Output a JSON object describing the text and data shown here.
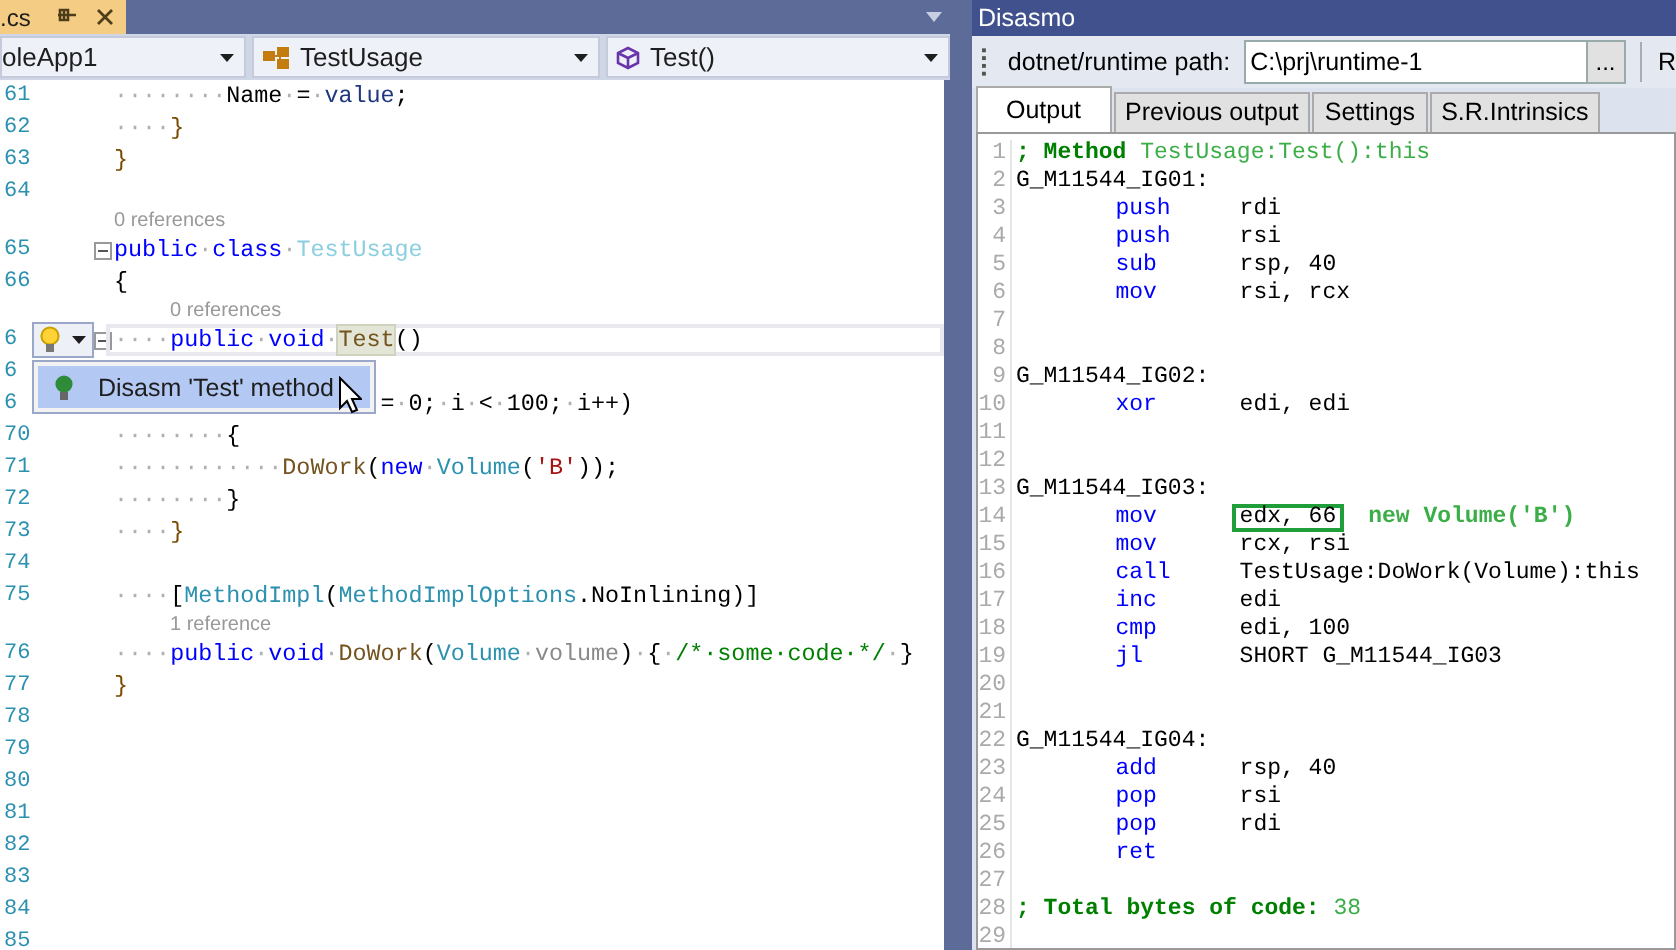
{
  "editor": {
    "document_tab": {
      "label": ".cs"
    },
    "navigation": {
      "project": "oleApp1",
      "class": "TestUsage",
      "member": "Test()"
    },
    "lines": [
      {
        "kind": "code",
        "number": "61",
        "current": false,
        "foldable": false,
        "code": [
          {
            "kind": "ws",
            "text": "········"
          },
          {
            "kind": "plain",
            "text": "Name"
          },
          {
            "kind": "ws",
            "text": "·"
          },
          {
            "kind": "plain",
            "text": "="
          },
          {
            "kind": "ws",
            "text": "·"
          },
          {
            "kind": "param",
            "text": "value"
          },
          {
            "kind": "plain",
            "text": ";"
          }
        ]
      },
      {
        "kind": "code",
        "number": "62",
        "current": false,
        "foldable": false,
        "code": [
          {
            "kind": "ws",
            "text": "····"
          },
          {
            "kind": "brace",
            "text": "}"
          }
        ]
      },
      {
        "kind": "code",
        "number": "63",
        "current": false,
        "foldable": false,
        "code": [
          {
            "kind": "brace",
            "text": "}"
          }
        ]
      },
      {
        "kind": "code",
        "number": "64",
        "current": false,
        "foldable": false
      },
      {
        "kind": "lens",
        "text": "0 references"
      },
      {
        "kind": "code",
        "number": "65",
        "current": false,
        "foldable": true,
        "code": [
          {
            "kind": "kw",
            "text": "public"
          },
          {
            "kind": "ws",
            "text": "·"
          },
          {
            "kind": "kw",
            "text": "class"
          },
          {
            "kind": "ws",
            "text": "·"
          },
          {
            "kind": "type-unused",
            "text": "TestUsage"
          }
        ]
      },
      {
        "kind": "code",
        "number": "66",
        "current": false,
        "foldable": false,
        "code": [
          {
            "kind": "plain",
            "text": "{"
          }
        ]
      },
      {
        "kind": "lens",
        "text": "0 references"
      },
      {
        "kind": "code",
        "number": "6",
        "current": true,
        "foldable": true,
        "code": [
          {
            "kind": "ws",
            "text": "····"
          },
          {
            "kind": "kw",
            "text": "public"
          },
          {
            "kind": "ws",
            "text": "·"
          },
          {
            "kind": "kw",
            "text": "void"
          },
          {
            "kind": "ws",
            "text": "·"
          },
          {
            "kind": "method-ref",
            "text": "Test"
          },
          {
            "kind": "plain",
            "text": "()"
          }
        ],
        "quick_actions": {
          "items": [
            {
              "label": "Disasm 'Test' method",
              "selected": true
            }
          ]
        }
      },
      {
        "kind": "code",
        "number": "6",
        "current": false
      },
      {
        "kind": "covered",
        "number": "6",
        "current": false,
        "code": [
          {
            "kind": "plain",
            "text": "="
          },
          {
            "kind": "ws",
            "text": "·"
          },
          {
            "kind": "plain",
            "text": "0;"
          },
          {
            "kind": "ws",
            "text": "·"
          },
          {
            "kind": "plain",
            "text": "i"
          },
          {
            "kind": "ws",
            "text": "·"
          },
          {
            "kind": "plain",
            "text": "<"
          },
          {
            "kind": "ws",
            "text": "·"
          },
          {
            "kind": "plain",
            "text": "100;"
          },
          {
            "kind": "ws",
            "text": "·"
          },
          {
            "kind": "plain",
            "text": "i++)"
          }
        ]
      },
      {
        "kind": "code",
        "number": "70",
        "current": false,
        "foldable": false,
        "code": [
          {
            "kind": "ws",
            "text": "········"
          },
          {
            "kind": "plain",
            "text": "{"
          }
        ]
      },
      {
        "kind": "code",
        "number": "71",
        "current": false,
        "foldable": false,
        "code": [
          {
            "kind": "ws",
            "text": "············"
          },
          {
            "kind": "method",
            "text": "DoWork"
          },
          {
            "kind": "plain",
            "text": "("
          },
          {
            "kind": "kw",
            "text": "new"
          },
          {
            "kind": "ws",
            "text": "·"
          },
          {
            "kind": "type",
            "text": "Volume"
          },
          {
            "kind": "plain",
            "text": "("
          },
          {
            "kind": "string",
            "text": "'B'"
          },
          {
            "kind": "plain",
            "text": "));"
          }
        ]
      },
      {
        "kind": "code",
        "number": "72",
        "current": false,
        "foldable": false,
        "code": [
          {
            "kind": "ws",
            "text": "········"
          },
          {
            "kind": "plain",
            "text": "}"
          }
        ]
      },
      {
        "kind": "code",
        "number": "73",
        "current": false,
        "foldable": false,
        "code": [
          {
            "kind": "ws",
            "text": "····"
          },
          {
            "kind": "brace",
            "text": "}"
          }
        ]
      },
      {
        "kind": "code",
        "number": "74",
        "current": false,
        "foldable": false
      },
      {
        "kind": "code",
        "number": "75",
        "current": false,
        "foldable": false,
        "code": [
          {
            "kind": "ws",
            "text": "····"
          },
          {
            "kind": "plain",
            "text": "["
          },
          {
            "kind": "type",
            "text": "MethodImpl"
          },
          {
            "kind": "plain",
            "text": "("
          },
          {
            "kind": "type",
            "text": "MethodImplOptions"
          },
          {
            "kind": "plain",
            "text": ".NoInlining)]"
          }
        ]
      },
      {
        "kind": "lens",
        "text": "1 reference"
      },
      {
        "kind": "code",
        "number": "76",
        "current": false,
        "foldable": false,
        "code": [
          {
            "kind": "ws",
            "text": "····"
          },
          {
            "kind": "kw",
            "text": "public"
          },
          {
            "kind": "ws",
            "text": "·"
          },
          {
            "kind": "kw",
            "text": "void"
          },
          {
            "kind": "ws",
            "text": "·"
          },
          {
            "kind": "method",
            "text": "DoWork"
          },
          {
            "kind": "plain",
            "text": "("
          },
          {
            "kind": "type",
            "text": "Volume"
          },
          {
            "kind": "ws",
            "text": "·"
          },
          {
            "kind": "param-unused",
            "text": "volume"
          },
          {
            "kind": "plain",
            "text": ")"
          },
          {
            "kind": "ws",
            "text": "·"
          },
          {
            "kind": "plain",
            "text": "{"
          },
          {
            "kind": "ws",
            "text": "·"
          },
          {
            "kind": "comment",
            "text": "/*·some·code·*/"
          },
          {
            "kind": "ws",
            "text": "·"
          },
          {
            "kind": "plain",
            "text": "}"
          }
        ]
      },
      {
        "kind": "code",
        "number": "77",
        "current": false,
        "foldable": false,
        "code": [
          {
            "kind": "brace",
            "text": "}"
          }
        ]
      },
      {
        "kind": "code",
        "number": "78",
        "current": false,
        "foldable": false
      },
      {
        "kind": "code",
        "number": "79",
        "current": false,
        "foldable": false
      },
      {
        "kind": "code",
        "number": "80",
        "current": false,
        "foldable": false
      },
      {
        "kind": "code",
        "number": "81",
        "current": false,
        "foldable": false
      },
      {
        "kind": "code",
        "number": "82",
        "current": false,
        "foldable": false
      },
      {
        "kind": "code",
        "number": "83",
        "current": false,
        "foldable": false
      },
      {
        "kind": "code",
        "number": "84",
        "current": false,
        "foldable": false
      },
      {
        "kind": "code",
        "number": "85",
        "current": false,
        "foldable": false
      }
    ]
  },
  "disasmo": {
    "title": "Disasmo",
    "runtime_label": "dotnet/runtime path:",
    "runtime_path": "C:\\prj\\runtime-1",
    "browse": "...",
    "cut_label": "R",
    "tabs": [
      {
        "label": "Output",
        "selected": true
      },
      {
        "label": "Previous output",
        "selected": false
      },
      {
        "label": "Settings",
        "selected": false
      },
      {
        "label": "S.R.Intrinsics",
        "selected": false
      }
    ],
    "lines": [
      {
        "number": "1",
        "kind": "comment",
        "text": "; Method",
        "value": " TestUsage:Test():this"
      },
      {
        "number": "2",
        "kind": "label",
        "text": "G_M11544_IG01:"
      },
      {
        "number": "3",
        "kind": "instr",
        "mnemonic": "push",
        "operands": "rdi",
        "boxed": false
      },
      {
        "number": "4",
        "kind": "instr",
        "mnemonic": "push",
        "operands": "rsi",
        "boxed": false
      },
      {
        "number": "5",
        "kind": "instr",
        "mnemonic": "sub",
        "operands": "rsp, 40",
        "boxed": false
      },
      {
        "number": "6",
        "kind": "instr",
        "mnemonic": "mov",
        "operands": "rsi, rcx",
        "boxed": false
      },
      {
        "number": "7",
        "kind": "blank"
      },
      {
        "number": "8",
        "kind": "blank"
      },
      {
        "number": "9",
        "kind": "label",
        "text": "G_M11544_IG02:"
      },
      {
        "number": "10",
        "kind": "instr",
        "mnemonic": "xor",
        "operands": "edi, edi",
        "boxed": false
      },
      {
        "number": "11",
        "kind": "blank"
      },
      {
        "number": "12",
        "kind": "blank"
      },
      {
        "number": "13",
        "kind": "label",
        "text": "G_M11544_IG03:"
      },
      {
        "number": "14",
        "kind": "instr",
        "mnemonic": "mov",
        "operands": "edx, 66",
        "boxed": true,
        "note": "new Volume('B')"
      },
      {
        "number": "15",
        "kind": "instr",
        "mnemonic": "mov",
        "operands": "rcx, rsi",
        "boxed": false
      },
      {
        "number": "16",
        "kind": "instr",
        "mnemonic": "call",
        "operands": "TestUsage:DoWork(Volume):this",
        "boxed": false
      },
      {
        "number": "17",
        "kind": "instr",
        "mnemonic": "inc",
        "operands": "edi",
        "boxed": false
      },
      {
        "number": "18",
        "kind": "instr",
        "mnemonic": "cmp",
        "operands": "edi, 100",
        "boxed": false
      },
      {
        "number": "19",
        "kind": "instr",
        "mnemonic": "jl",
        "operands": "SHORT G_M11544_IG03",
        "boxed": false
      },
      {
        "number": "20",
        "kind": "blank"
      },
      {
        "number": "21",
        "kind": "blank"
      },
      {
        "number": "22",
        "kind": "label",
        "text": "G_M11544_IG04:"
      },
      {
        "number": "23",
        "kind": "instr",
        "mnemonic": "add",
        "operands": "rsp, 40",
        "boxed": false
      },
      {
        "number": "24",
        "kind": "instr",
        "mnemonic": "pop",
        "operands": "rsi",
        "boxed": false
      },
      {
        "number": "25",
        "kind": "instr",
        "mnemonic": "pop",
        "operands": "rdi",
        "boxed": false
      },
      {
        "number": "26",
        "kind": "instr",
        "mnemonic": "ret",
        "boxed": false
      },
      {
        "number": "27",
        "kind": "blank"
      },
      {
        "number": "28",
        "kind": "comment",
        "text": "; Total bytes of code:",
        "value": " 38"
      },
      {
        "number": "29",
        "kind": "blank"
      }
    ]
  }
}
